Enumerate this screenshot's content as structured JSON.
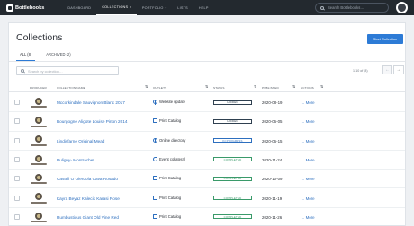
{
  "app": {
    "name": "Bottlebooks",
    "nav": [
      {
        "label": "DASHBOARD",
        "active": false,
        "caret": false
      },
      {
        "label": "COLLECTIONS",
        "active": true,
        "caret": true
      },
      {
        "label": "PORTFOLIO",
        "active": false,
        "caret": true
      },
      {
        "label": "LISTS",
        "active": false,
        "caret": false
      },
      {
        "label": "HELP",
        "active": false,
        "caret": false
      }
    ],
    "search_placeholder": "Search Bottlebooks…"
  },
  "page": {
    "title": "Collections",
    "start_button": "Start Collection",
    "tabs": [
      {
        "label": "ALL (8)",
        "active": true
      },
      {
        "label": "ARCHIVED (2)",
        "active": false
      }
    ],
    "search_placeholder": "Search by collection…",
    "pager_text": "1-10 of (8)",
    "pager_prev": "←",
    "pager_next": "→"
  },
  "table": {
    "headers": {
      "producer": "PRODUCER",
      "collection_name": "COLLECTION NAME",
      "outlets": "OUTLETS",
      "status": "STATUS",
      "published": "PUBLISHED",
      "actions": "ACTIONS"
    },
    "rows": [
      {
        "name": "Mccorkindale Sauvignon Blanc 2017",
        "outlet": "Website update",
        "outlet_icon": "globe-icon",
        "status": "HIDDEN",
        "status_kind": "hidden",
        "published": "2020-08-19",
        "more": "… More"
      },
      {
        "name": "Bourgogne Aligote Louise Pinon 2014",
        "outlet": "Print Catalog",
        "outlet_icon": "print-icon",
        "status": "HIDDEN",
        "status_kind": "hidden",
        "published": "2020-06-05",
        "more": "… More"
      },
      {
        "name": "Lindisfarne Original Mead",
        "outlet": "Online directory",
        "outlet_icon": "globe-icon",
        "status": "IN PROGRESS",
        "status_kind": "inprog",
        "published": "2020-06-15",
        "more": "… More"
      },
      {
        "name": "Puligny- Montrachet",
        "outlet": "Event collateral",
        "outlet_icon": "event-icon",
        "status": "COMPLETED",
        "status_kind": "completed",
        "published": "2020-11-24",
        "more": "… More"
      },
      {
        "name": "Castell O Oierdola Cava Rosado",
        "outlet": "Print Catalog",
        "outlet_icon": "print-icon",
        "status": "COMPLETED",
        "status_kind": "completed",
        "published": "2020-10-09",
        "more": "… More"
      },
      {
        "name": "Kayra Beyaz Kalecik Karasi Rose",
        "outlet": "Print Catalog",
        "outlet_icon": "print-icon",
        "status": "COMPLETED",
        "status_kind": "completed",
        "published": "2020-11-19",
        "more": "… More"
      },
      {
        "name": "Rumbustious Giant Old Vine Red",
        "outlet": "Print Catalog",
        "outlet_icon": "print-icon",
        "status": "COMPLETED",
        "status_kind": "completed",
        "published": "2020-11-26",
        "more": "… More"
      }
    ]
  }
}
